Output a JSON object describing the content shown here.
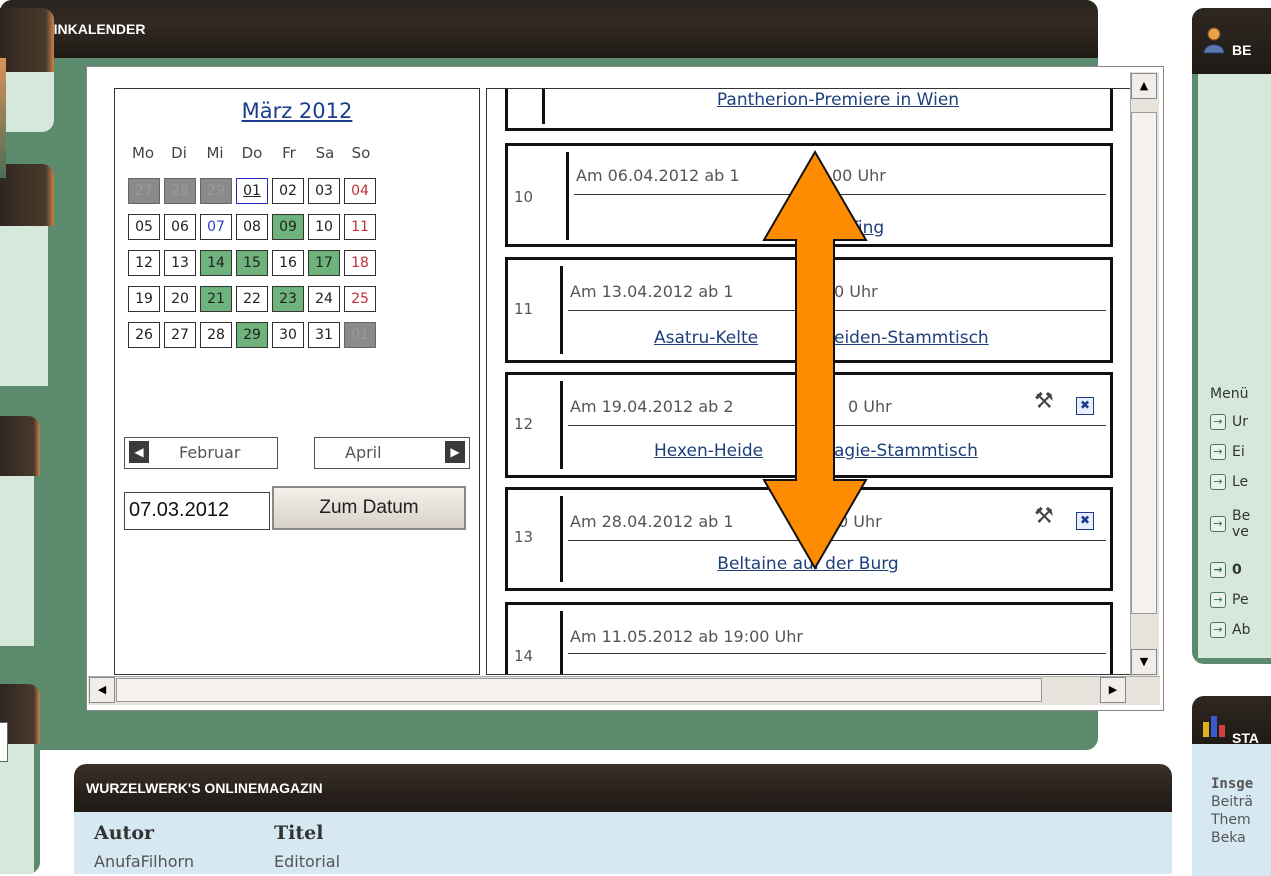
{
  "termin": {
    "title": "TERMINKALENDER"
  },
  "calendar": {
    "month_title": "März 2012",
    "weekdays": [
      "Mo",
      "Di",
      "Mi",
      "Do",
      "Fr",
      "Sa",
      "So"
    ],
    "weeks": [
      [
        {
          "d": "27",
          "s": "grey"
        },
        {
          "d": "28",
          "s": "grey"
        },
        {
          "d": "29",
          "s": "grey"
        },
        {
          "d": "01",
          "s": "today"
        },
        {
          "d": "02",
          "s": ""
        },
        {
          "d": "03",
          "s": ""
        },
        {
          "d": "04",
          "s": "sun"
        }
      ],
      [
        {
          "d": "05",
          "s": ""
        },
        {
          "d": "06",
          "s": ""
        },
        {
          "d": "07",
          "s": "blue"
        },
        {
          "d": "08",
          "s": ""
        },
        {
          "d": "09",
          "s": "green"
        },
        {
          "d": "10",
          "s": ""
        },
        {
          "d": "11",
          "s": "sun"
        }
      ],
      [
        {
          "d": "12",
          "s": ""
        },
        {
          "d": "13",
          "s": ""
        },
        {
          "d": "14",
          "s": "green"
        },
        {
          "d": "15",
          "s": "green"
        },
        {
          "d": "16",
          "s": ""
        },
        {
          "d": "17",
          "s": "green"
        },
        {
          "d": "18",
          "s": "sun"
        }
      ],
      [
        {
          "d": "19",
          "s": ""
        },
        {
          "d": "20",
          "s": ""
        },
        {
          "d": "21",
          "s": "green"
        },
        {
          "d": "22",
          "s": ""
        },
        {
          "d": "23",
          "s": "green"
        },
        {
          "d": "24",
          "s": ""
        },
        {
          "d": "25",
          "s": "sun"
        }
      ],
      [
        {
          "d": "26",
          "s": ""
        },
        {
          "d": "27",
          "s": ""
        },
        {
          "d": "28",
          "s": ""
        },
        {
          "d": "29",
          "s": "green"
        },
        {
          "d": "30",
          "s": ""
        },
        {
          "d": "31",
          "s": ""
        },
        {
          "d": "01",
          "s": "grey"
        }
      ]
    ],
    "prev_label": "Februar",
    "next_label": "April",
    "date_value": "07.03.2012",
    "goto_button": "Zum Datum"
  },
  "events": [
    {
      "num": "",
      "date": "",
      "title": "Pantherion-Premiere in Wien",
      "tools": false
    },
    {
      "num": "10",
      "date": "Am 06.04.2012 ab 1",
      "date_end": "00 Uhr",
      "title": "Ting",
      "tools": false
    },
    {
      "num": "11",
      "date": "Am 13.04.2012 ab 1",
      "date_end": "0 Uhr",
      "title": "Asatru-Kelte",
      "title_end": "eiden-Stammtisch",
      "tools": false
    },
    {
      "num": "12",
      "date": "Am 19.04.2012 ab 2",
      "date_end": "0 Uhr",
      "title": "Hexen-Heide",
      "title_end": "agie-Stammtisch",
      "tools": true
    },
    {
      "num": "13",
      "date": "Am 28.04.2012 ab 1",
      "date_end": "0 Uhr",
      "title": "Beltaine auf der Burg",
      "tools": true
    },
    {
      "num": "14",
      "date": "Am 11.05.2012 ab 19:00 Uhr",
      "title": "",
      "tools": false
    }
  ],
  "magazine": {
    "title": "WURZELWERK'S ONLINEMAGAZIN",
    "col_author": "Autor",
    "col_title": "Titel",
    "row_author": "AnufaFilhorn",
    "row_title": "Editorial"
  },
  "right_panel": {
    "head1": "BE",
    "menu_label": "Menü",
    "items": [
      "Ur",
      "Ei",
      "Le",
      "Be",
      "ve",
      "0",
      "Pe",
      "Ab"
    ],
    "head2": "STA",
    "stats": [
      "Insge",
      "Beiträ",
      "Them",
      "Beka"
    ]
  },
  "colors": {
    "accent_green": "#6fb37c",
    "panel_dark": "#2a221c",
    "arrow_orange": "#ff8c00",
    "link_blue": "#1d3f7c"
  }
}
